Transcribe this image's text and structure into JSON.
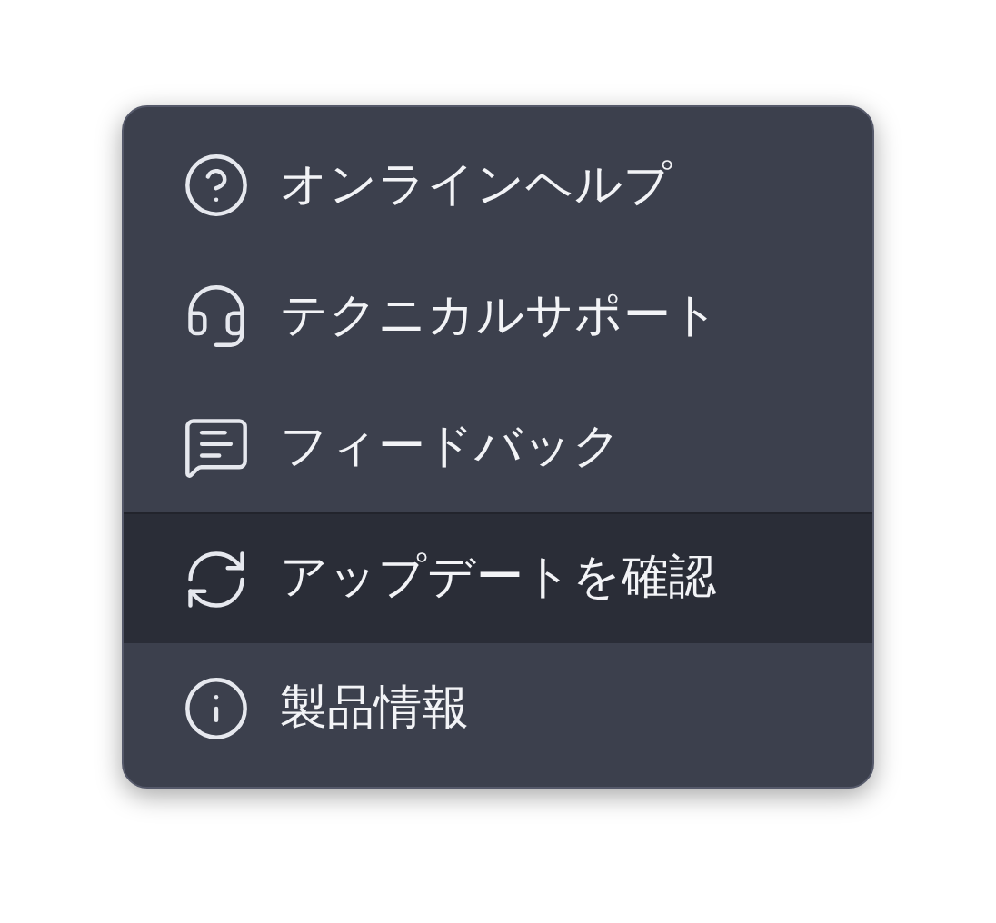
{
  "menu": {
    "items": [
      {
        "kind": "help",
        "label": "オンラインヘルプ",
        "selected": false
      },
      {
        "kind": "support",
        "label": "テクニカルサポート",
        "selected": false
      },
      {
        "kind": "feedback",
        "label": "フィードバック",
        "selected": false
      },
      {
        "kind": "update",
        "label": "アップデートを確認",
        "selected": true
      },
      {
        "kind": "about",
        "label": "製品情報",
        "selected": false
      }
    ]
  }
}
